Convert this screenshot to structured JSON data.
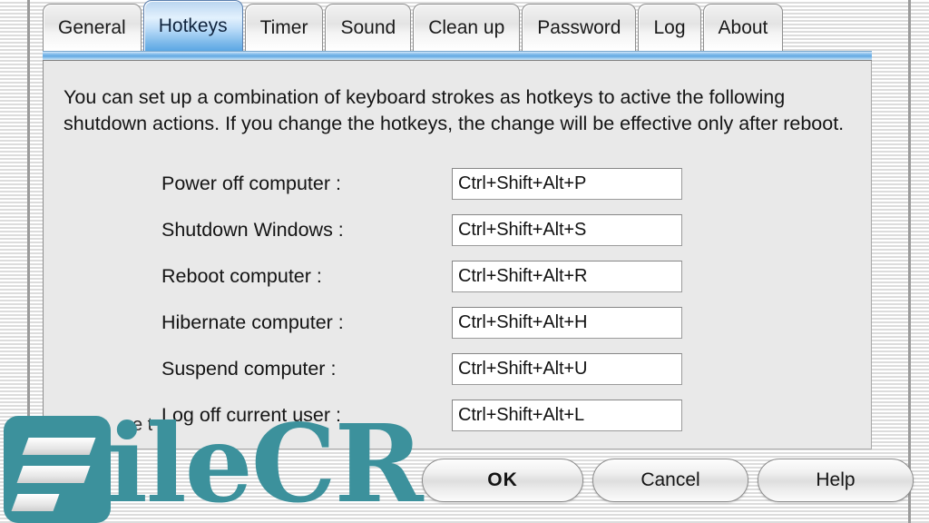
{
  "dialog": {
    "active_tab": "Hotkeys",
    "tabs": [
      {
        "label": "General",
        "active": false
      },
      {
        "label": "Hotkeys",
        "active": true
      },
      {
        "label": "Timer",
        "active": false
      },
      {
        "label": "Sound",
        "active": false
      },
      {
        "label": "Clean up",
        "active": false
      },
      {
        "label": "Password",
        "active": false
      },
      {
        "label": "Log",
        "active": false
      },
      {
        "label": "About",
        "active": false
      }
    ],
    "description": "You can set up a combination of keyboard strokes as hotkeys to active the following shutdown actions. If you change the hotkeys, the change will be effective only after reboot.",
    "hotkeys": [
      {
        "label": "Power off computer :",
        "value": "Ctrl+Shift+Alt+P"
      },
      {
        "label": "Shutdown Windows :",
        "value": "Ctrl+Shift+Alt+S"
      },
      {
        "label": "Reboot computer :",
        "value": "Ctrl+Shift+Alt+R"
      },
      {
        "label": "Hibernate computer :",
        "value": "Ctrl+Shift+Alt+H"
      },
      {
        "label": "Suspend computer :",
        "value": "Ctrl+Shift+Alt+U"
      },
      {
        "label": "Log off current user :",
        "value": "Ctrl+Shift+Alt+L"
      }
    ],
    "obscured_control_text": "e  t",
    "buttons": {
      "ok": "OK",
      "cancel": "Cancel",
      "help": "Help"
    }
  },
  "watermark": {
    "text": "ileCR",
    "color": "#3c919c"
  }
}
